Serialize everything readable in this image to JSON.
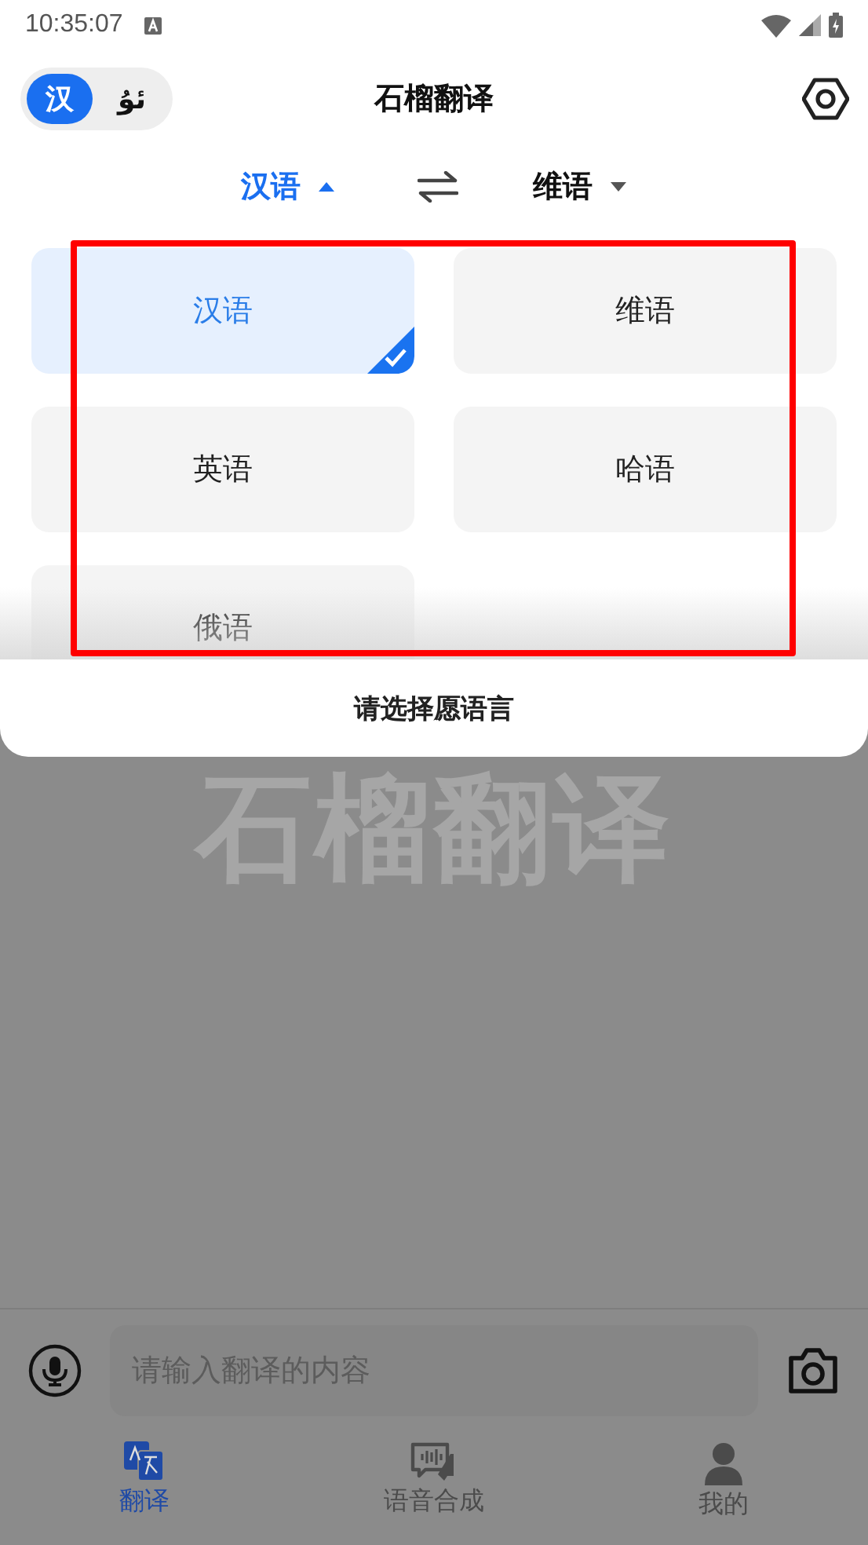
{
  "status_bar": {
    "time": "10:35:07"
  },
  "header": {
    "script_toggle": [
      {
        "label": "汉",
        "selected": true
      },
      {
        "label": "ئۇ",
        "selected": false
      }
    ],
    "title": "石榴翻译"
  },
  "language_bar": {
    "source": {
      "label": "汉语",
      "expanded": true
    },
    "target": {
      "label": "维语",
      "expanded": false
    }
  },
  "language_options": [
    {
      "label": "汉语",
      "selected": true
    },
    {
      "label": "维语",
      "selected": false
    },
    {
      "label": "英语",
      "selected": false
    },
    {
      "label": "哈语",
      "selected": false
    },
    {
      "label": "俄语",
      "selected": false
    }
  ],
  "sheet_title": "请选择愿语言",
  "background_logo": "石榴翻译",
  "input": {
    "placeholder": "请输入翻译的内容"
  },
  "tabs": [
    {
      "label": "翻译",
      "selected": true
    },
    {
      "label": "语音合成",
      "selected": false
    },
    {
      "label": "我的",
      "selected": false
    }
  ]
}
